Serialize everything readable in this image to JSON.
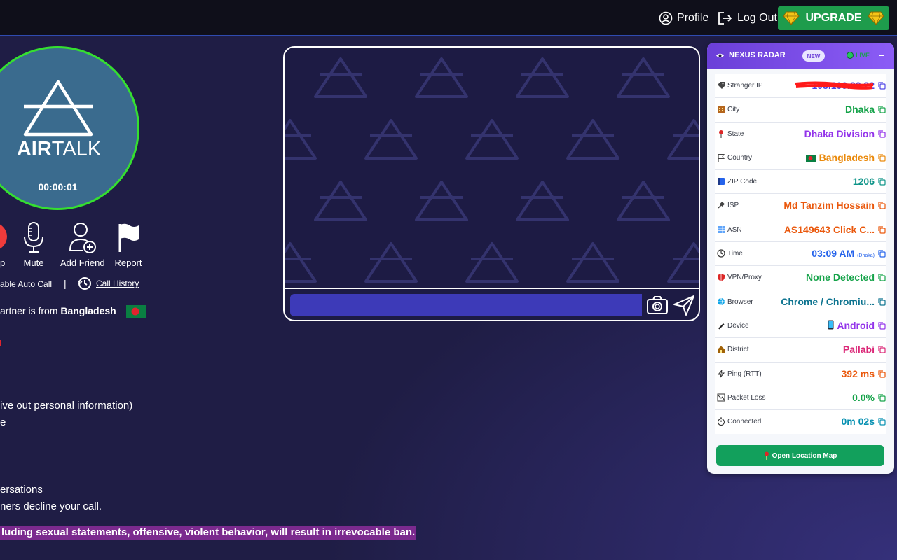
{
  "topbar": {
    "profile_label": "Profile",
    "logout_label": "Log Out",
    "upgrade_label": "UPGRADE"
  },
  "logo": {
    "brand_air": "AIR",
    "brand_talk": "TALK",
    "timer": "00:00:01"
  },
  "actions": [
    {
      "name": "skip",
      "label": "p"
    },
    {
      "name": "mute",
      "label": "Mute"
    },
    {
      "name": "add-friend",
      "label": "Add Friend"
    },
    {
      "name": "report",
      "label": "Report"
    }
  ],
  "controls": {
    "auto_call": "able Auto Call",
    "separator": "|",
    "call_history": "Call History"
  },
  "partner": {
    "prefix": "artner is from ",
    "country": "Bangladesh"
  },
  "rules": [
    "ive out personal information)",
    "e",
    "ersations",
    "ners decline your call."
  ],
  "ban_notice": "luding sexual statements, offensive, violent behavior, will result in irrevocable ban.",
  "radar": {
    "title": "NEXUS RADAR",
    "badge": "NEW",
    "live": "LIVE",
    "minimize": "–",
    "rows": [
      {
        "key": "Stranger IP",
        "value": "103.100.22.22",
        "color": "#4f46e5"
      },
      {
        "key": "City",
        "value": "Dhaka",
        "color": "#16a34a"
      },
      {
        "key": "State",
        "value": "Dhaka Division",
        "color": "#9333ea"
      },
      {
        "key": "Country",
        "value": "Bangladesh",
        "color": "#ea8a0c"
      },
      {
        "key": "ZIP Code",
        "value": "1206",
        "color": "#0d9488"
      },
      {
        "key": "ISP",
        "value": "Md Tanzim Hossain",
        "color": "#ea580c"
      },
      {
        "key": "ASN",
        "value": "AS149643 Click C...",
        "color": "#ea580c"
      },
      {
        "key": "Time",
        "value": "03:09 AM",
        "sub": "(Dhaka)",
        "color": "#2563eb"
      },
      {
        "key": "VPN/Proxy",
        "value": "None Detected",
        "color": "#16a34a"
      },
      {
        "key": "Browser",
        "value": "Chrome / Chromiu...",
        "color": "#0e7490"
      },
      {
        "key": "Device",
        "value": "Android",
        "color": "#9333ea"
      },
      {
        "key": "District",
        "value": "Pallabi",
        "color": "#db2777"
      },
      {
        "key": "Ping (RTT)",
        "value": "392 ms",
        "color": "#ea580c"
      },
      {
        "key": "Packet Loss",
        "value": "0.0%",
        "color": "#16a34a"
      },
      {
        "key": "Connected",
        "value": "0m 02s",
        "color": "#0891b2"
      }
    ],
    "map_button": "Open Location Map"
  },
  "chat": {
    "placeholder": ""
  }
}
